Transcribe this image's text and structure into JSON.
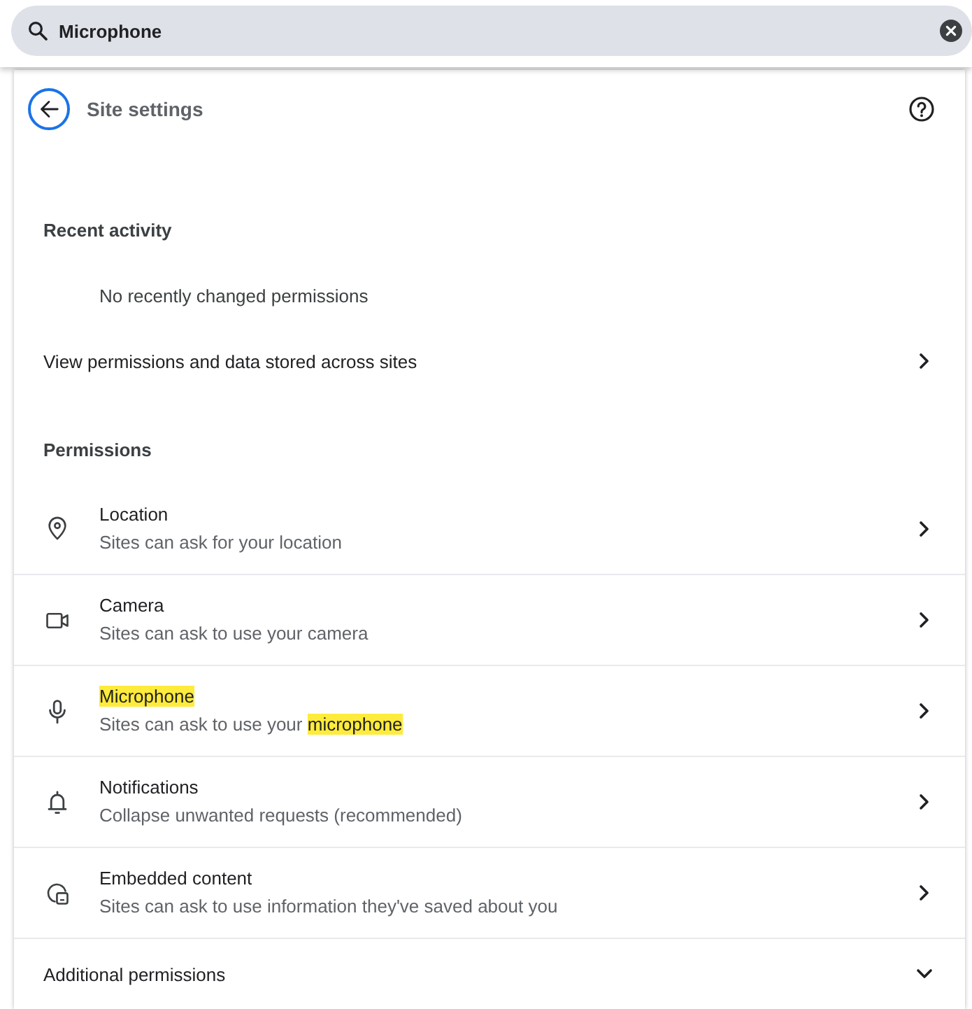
{
  "search": {
    "value": "Microphone"
  },
  "header": {
    "title": "Site settings"
  },
  "recent_activity": {
    "heading": "Recent activity",
    "empty_text": "No recently changed permissions",
    "link": "View permissions and data stored across sites"
  },
  "permissions": {
    "heading": "Permissions",
    "items": [
      {
        "kind": "location",
        "title": [
          {
            "text": "Location",
            "highlighted": false
          }
        ],
        "description": [
          {
            "text": "Sites can ask for your location",
            "highlighted": false
          }
        ]
      },
      {
        "kind": "camera",
        "title": [
          {
            "text": "Camera",
            "highlighted": false
          }
        ],
        "description": [
          {
            "text": "Sites can ask to use your camera",
            "highlighted": false
          }
        ]
      },
      {
        "kind": "microphone",
        "title": [
          {
            "text": "Microphone",
            "highlighted": true
          }
        ],
        "description": [
          {
            "text": "Sites can ask to use your ",
            "highlighted": false
          },
          {
            "text": "microphone",
            "highlighted": true
          }
        ]
      },
      {
        "kind": "notifications",
        "title": [
          {
            "text": "Notifications",
            "highlighted": false
          }
        ],
        "description": [
          {
            "text": "Collapse unwanted requests (recommended)",
            "highlighted": false
          }
        ]
      },
      {
        "kind": "embedded",
        "title": [
          {
            "text": "Embedded content",
            "highlighted": false
          }
        ],
        "description": [
          {
            "text": "Sites can ask to use information they've saved about you",
            "highlighted": false
          }
        ]
      }
    ],
    "more": {
      "label": "Additional permissions",
      "expanded": false
    }
  }
}
